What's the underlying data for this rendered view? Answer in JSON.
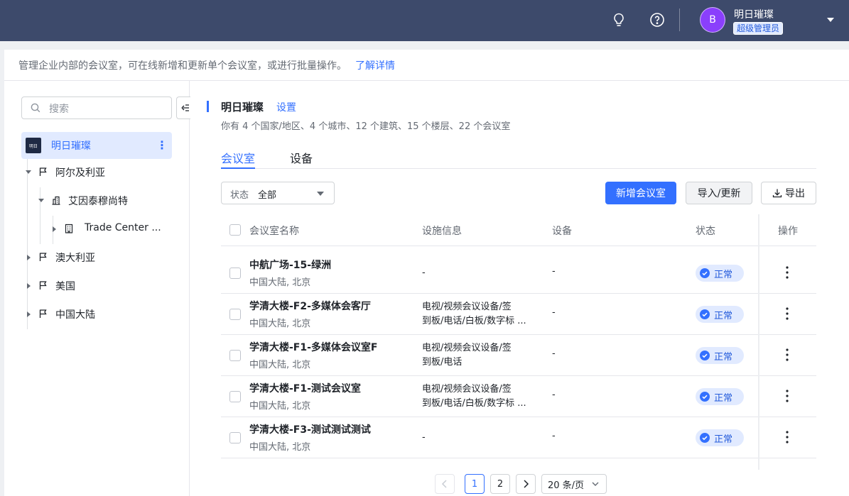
{
  "header": {
    "avatar_initial": "B",
    "user_name": "明日璀璨",
    "user_role": "超级管理员"
  },
  "description": {
    "text": "管理企业内部的会议室，可在线新增和更新单个会议室，或进行批量操作。",
    "link": "了解详情"
  },
  "sidebar": {
    "search_placeholder": "搜索",
    "root": {
      "logo_text": "明日",
      "label": "明日璀璨"
    },
    "tree": [
      {
        "label": "阿尔及利亚"
      },
      {
        "label": "艾因泰穆尚特"
      },
      {
        "label": "Trade Center ..."
      },
      {
        "label": "澳大利亚"
      },
      {
        "label": "美国"
      },
      {
        "label": "中国大陆"
      }
    ]
  },
  "org": {
    "name": "明日璀璨",
    "settings_link": "设置",
    "stats": "你有 4 个国家/地区、4 个城市、12 个建筑、15 个楼层、22 个会议室"
  },
  "tabs": [
    {
      "label": "会议室",
      "active": true
    },
    {
      "label": "设备",
      "active": false
    }
  ],
  "filter": {
    "label": "状态",
    "value": "全部"
  },
  "toolbar": {
    "add_label": "新增会议室",
    "import_label": "导入/更新",
    "export_label": "导出"
  },
  "table": {
    "columns": [
      "会议室名称",
      "设施信息",
      "设备",
      "状态",
      "操作"
    ],
    "rows": [
      {
        "name": "中航广场-15-绿洲",
        "location": "中国大陆, 北京",
        "facilities_line1": "-",
        "facilities_line2": "",
        "devices": "-",
        "status": "正常"
      },
      {
        "name": "学清大楼-F2-多媒体会客厅",
        "location": "中国大陆, 北京",
        "facilities_line1": "电视/视频会议设备/签",
        "facilities_line2": "到板/电话/白板/数字标 ...",
        "devices": "-",
        "status": "正常"
      },
      {
        "name": "学清大楼-F1-多媒体会议室F",
        "location": "中国大陆, 北京",
        "facilities_line1": "电视/视频会议设备/签",
        "facilities_line2": "到板/电话",
        "devices": "-",
        "status": "正常"
      },
      {
        "name": "学清大楼-F1-测试会议室",
        "location": "中国大陆, 北京",
        "facilities_line1": "电视/视频会议设备/签",
        "facilities_line2": "到板/电话/白板/数字标 ...",
        "devices": "-",
        "status": "正常"
      },
      {
        "name": "学清大楼-F3-测试测试测试",
        "location": "中国大陆, 北京",
        "facilities_line1": "-",
        "facilities_line2": "",
        "devices": "-",
        "status": "正常"
      }
    ]
  },
  "pagination": {
    "pages": [
      "1",
      "2"
    ],
    "current": "1",
    "page_size": "20 条/页"
  },
  "colors": {
    "topbar": "#3d4a6b",
    "accent": "#3370ff",
    "avatar": "#8a3ffc"
  }
}
